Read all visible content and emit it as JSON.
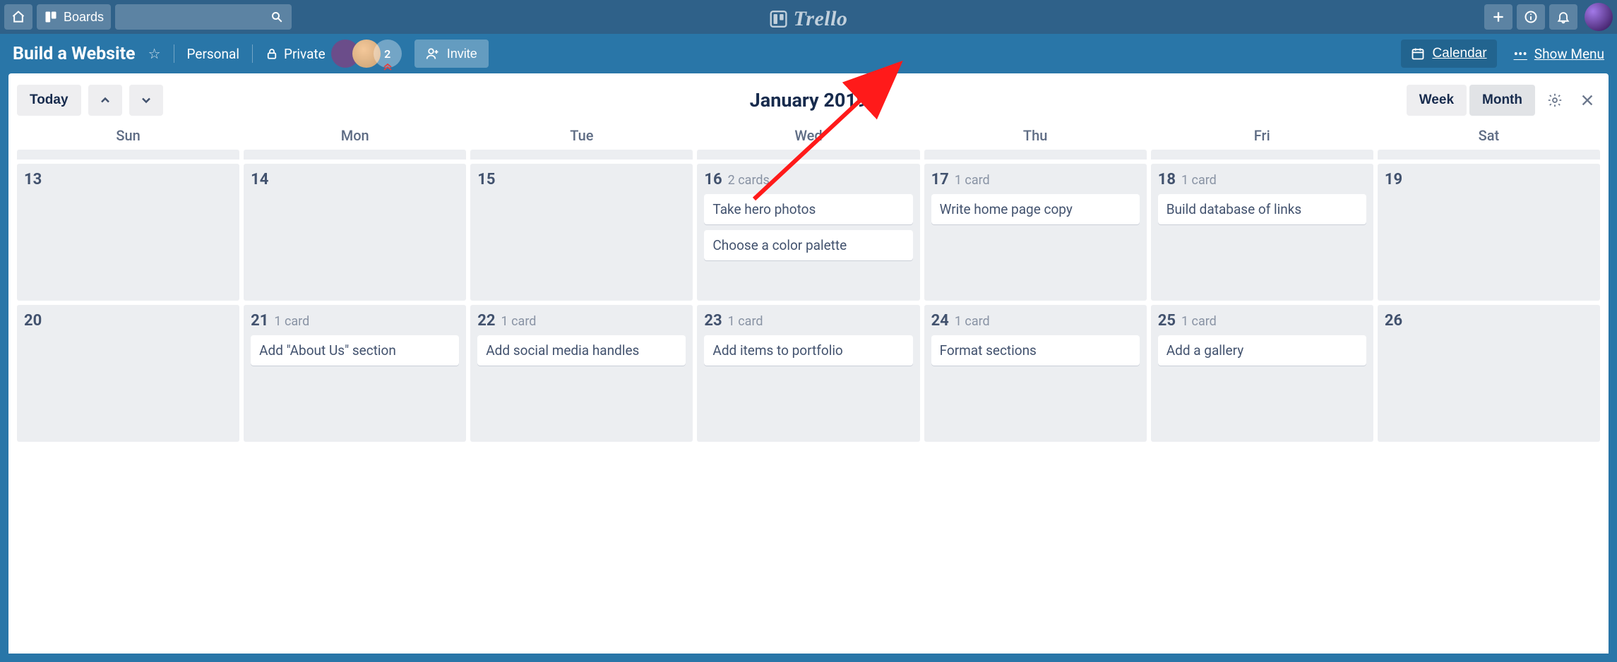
{
  "topbar": {
    "boards_label": "Boards",
    "brand": "Trello"
  },
  "board": {
    "title": "Build a Website",
    "team_label": "Personal",
    "visibility_label": "Private",
    "member_count": "2",
    "invite_label": "Invite",
    "calendar_label": "Calendar",
    "show_menu_label": "Show Menu"
  },
  "calendar": {
    "today_label": "Today",
    "title": "January 2019",
    "week_label": "Week",
    "month_label": "Month",
    "days_of_week": [
      "Sun",
      "Mon",
      "Tue",
      "Wed",
      "Thu",
      "Fri",
      "Sat"
    ],
    "weeks": [
      {
        "days": [
          {
            "num": "13"
          },
          {
            "num": "14"
          },
          {
            "num": "15"
          },
          {
            "num": "16",
            "count": "2 cards",
            "cards": [
              "Take hero photos",
              "Choose a color palette"
            ]
          },
          {
            "num": "17",
            "count": "1 card",
            "cards": [
              "Write home page copy"
            ]
          },
          {
            "num": "18",
            "count": "1 card",
            "cards": [
              "Build database of links"
            ]
          },
          {
            "num": "19"
          }
        ]
      },
      {
        "days": [
          {
            "num": "20"
          },
          {
            "num": "21",
            "count": "1 card",
            "cards": [
              "Add \"About Us\" section"
            ]
          },
          {
            "num": "22",
            "count": "1 card",
            "cards": [
              "Add social media handles"
            ]
          },
          {
            "num": "23",
            "count": "1 card",
            "cards": [
              "Add items to portfolio"
            ]
          },
          {
            "num": "24",
            "count": "1 card",
            "cards": [
              "Format sections"
            ]
          },
          {
            "num": "25",
            "count": "1 card",
            "cards": [
              "Add a gallery"
            ]
          },
          {
            "num": "26"
          }
        ]
      }
    ]
  }
}
